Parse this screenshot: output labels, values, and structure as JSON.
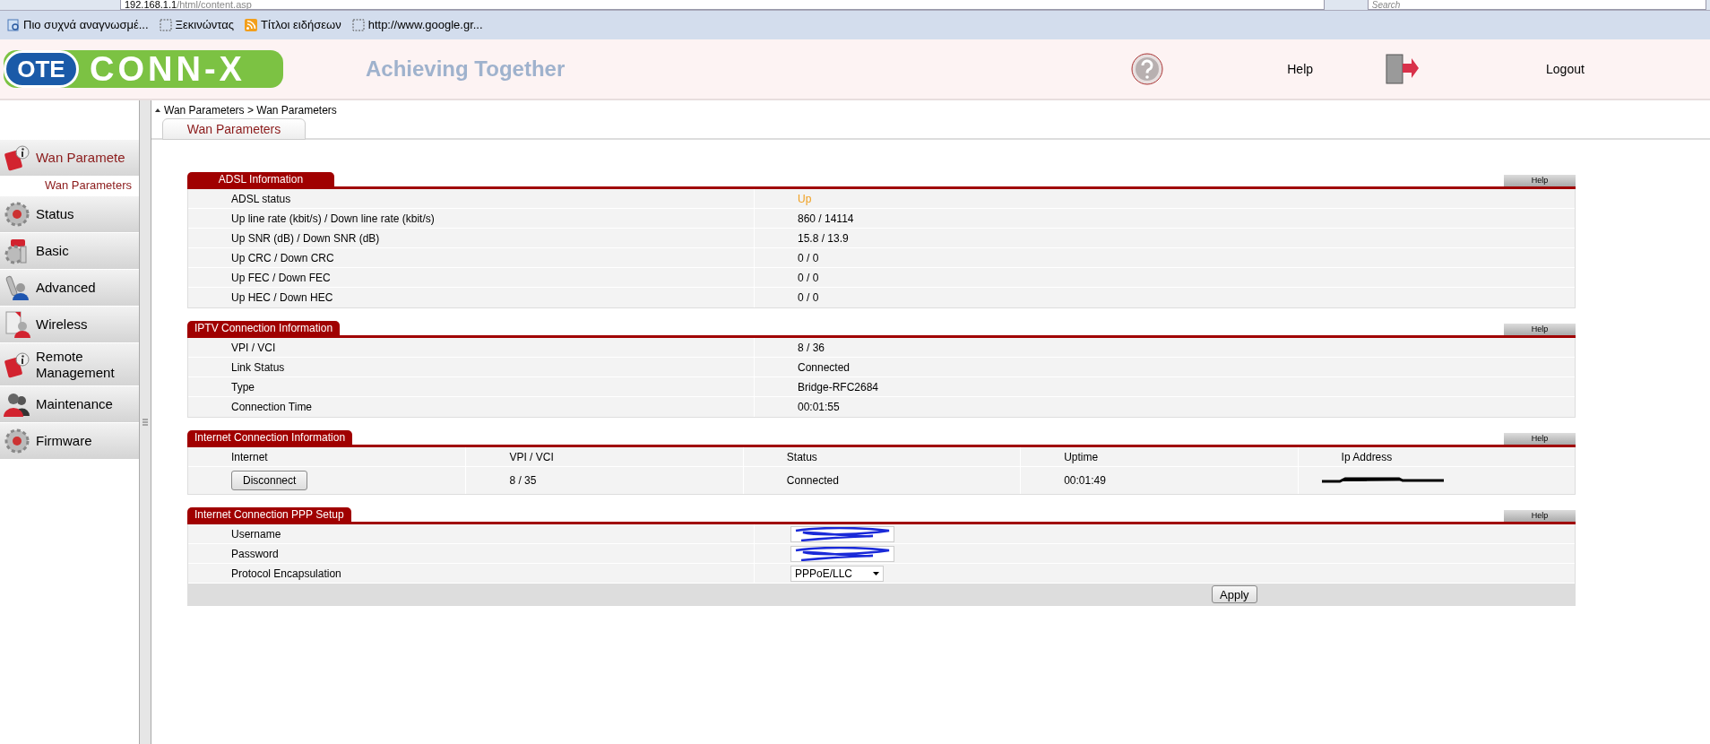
{
  "browser": {
    "url_host": "192.168.1.1",
    "url_path": "/html/content.asp",
    "search_placeholder": "Search",
    "bookmarks": [
      {
        "label": "Πιο συχνά αναγνωσμέ...",
        "kind": "feed-page"
      },
      {
        "label": "Ξεκινώντας",
        "kind": "page"
      },
      {
        "label": "Τίτλοι ειδήσεων",
        "kind": "rss"
      },
      {
        "label": "http://www.google.gr...",
        "kind": "page"
      }
    ]
  },
  "header": {
    "logo_badge": "OTE",
    "logo_text": "CONN-X",
    "slogan": "Achieving Together",
    "help": "Help",
    "logout": "Logout"
  },
  "breadcrumb": "Wan Parameters > Wan Parameters",
  "tabs": [
    {
      "label": "Wan Parameters",
      "selected": true
    }
  ],
  "sidebar": {
    "items": [
      {
        "label": "Wan Paramete",
        "kind": "info",
        "selected": true,
        "children": [
          {
            "label": "Wan Parameters",
            "selected": true
          }
        ]
      },
      {
        "label": "Status",
        "kind": "gear",
        "selected": false
      },
      {
        "label": "Basic",
        "kind": "tools",
        "selected": false
      },
      {
        "label": "Advanced",
        "kind": "wrench-user",
        "selected": false
      },
      {
        "label": "Wireless",
        "kind": "doc-user",
        "selected": false
      },
      {
        "label": "Remote Management",
        "kind": "info",
        "selected": false
      },
      {
        "label": "Maintenance",
        "kind": "users",
        "selected": false
      },
      {
        "label": "Firmware",
        "kind": "gear",
        "selected": false
      }
    ]
  },
  "adsl": {
    "title": "ADSL Information",
    "help": "Help",
    "rows": [
      {
        "label": "ADSL status",
        "value": "Up",
        "kind": "status"
      },
      {
        "label": "Up line rate (kbit/s) / Down line rate (kbit/s)",
        "value": "860 / 14114",
        "kind": "text"
      },
      {
        "label": "Up SNR (dB) / Down SNR (dB)",
        "value": "15.8 / 13.9",
        "kind": "text"
      },
      {
        "label": "Up CRC / Down CRC",
        "value": "0 / 0",
        "kind": "text"
      },
      {
        "label": "Up FEC / Down FEC",
        "value": "0 / 0",
        "kind": "text"
      },
      {
        "label": "Up HEC / Down HEC",
        "value": "0 / 0",
        "kind": "text"
      }
    ]
  },
  "iptv": {
    "title": "IPTV Connection Information",
    "help": "Help",
    "rows": [
      {
        "label": "VPI / VCI",
        "value": "8 / 36",
        "kind": "text"
      },
      {
        "label": "Link Status",
        "value": "Connected",
        "kind": "text"
      },
      {
        "label": "Type",
        "value": "Bridge-RFC2684",
        "kind": "text"
      },
      {
        "label": "Connection Time",
        "value": "00:01:55",
        "kind": "text"
      }
    ]
  },
  "internet": {
    "title": "Internet Connection Information",
    "help": "Help",
    "columns": [
      "Internet",
      "VPI / VCI",
      "Status",
      "Uptime",
      "Ip Address"
    ],
    "rows": [
      {
        "button": "Disconnect",
        "vpi_vci": "8 / 35",
        "status": "Connected",
        "uptime": "00:01:49",
        "ip_redacted": true
      }
    ]
  },
  "ppp": {
    "title": "Internet Connection PPP Setup",
    "help": "Help",
    "rows": [
      {
        "label": "Username",
        "kind": "text-field",
        "redacted": true
      },
      {
        "label": "Password",
        "kind": "password-field",
        "redacted": true
      },
      {
        "label": "Protocol Encapsulation",
        "kind": "select",
        "value": "PPPoE/LLC"
      }
    ],
    "apply": "Apply"
  }
}
